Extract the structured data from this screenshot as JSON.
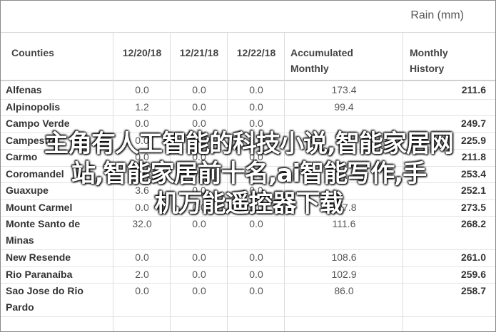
{
  "unit_label": "Rain (mm)",
  "headers": {
    "counties": "Counties",
    "d1": "12/20/18",
    "d2": "12/21/18",
    "d3": "12/22/18",
    "acc1": "Accumulated",
    "acc2": "Monthly",
    "hist1": "Monthly",
    "hist2": "History"
  },
  "rows": [
    {
      "name": [
        "Alfenas"
      ],
      "d1": "0.0",
      "d2": "0.0",
      "d3": "0.0",
      "acc": "173.4",
      "hist": "211.6"
    },
    {
      "name": [
        "Alpinopolis"
      ],
      "d1": "1.2",
      "d2": "0.0",
      "d3": "0.0",
      "acc": "99.4",
      "hist": ""
    },
    {
      "name": [
        "Campo Verde"
      ],
      "d1": "0.0",
      "d2": "0.0",
      "d3": "0.0",
      "acc": "",
      "hist": "249.7"
    },
    {
      "name": [
        "Campestre"
      ],
      "d1": "0.0",
      "d2": "0.0",
      "d3": "0.0",
      "acc": "",
      "hist": "225.9"
    },
    {
      "name": [
        "Carmo"
      ],
      "d1": "0.0",
      "d2": "0.0",
      "d3": "0.0",
      "acc": "",
      "hist": "211.8"
    },
    {
      "name": [
        "Coromandel"
      ],
      "d1": "0.0",
      "d2": "0.0",
      "d3": "0.0",
      "acc": "",
      "hist": "253.4"
    },
    {
      "name": [
        "Guaxupe"
      ],
      "d1": "3.6",
      "d2": "0.0",
      "d3": "0.0",
      "acc": "",
      "hist": "252.1"
    },
    {
      "name": [
        "Mount Carmel"
      ],
      "d1": "0.0",
      "d2": "0.0",
      "d3": "0.0",
      "acc": "187.8",
      "hist": "273.5"
    },
    {
      "name": [
        "Monte Santo de",
        "Minas"
      ],
      "d1": "32.0",
      "d2": "0.0",
      "d3": "0.0",
      "acc": "111.6",
      "hist": "268.2"
    },
    {
      "name": [
        "New Resende"
      ],
      "d1": "0.0",
      "d2": "0.0",
      "d3": "0.0",
      "acc": "108.6",
      "hist": "261.0"
    },
    {
      "name": [
        "Rio Paranaíba"
      ],
      "d1": "2.0",
      "d2": "0.0",
      "d3": "0.0",
      "acc": "102.9",
      "hist": "259.6"
    },
    {
      "name": [
        "Sao Jose do Rio",
        "Pardo"
      ],
      "d1": "0.0",
      "d2": "0.0",
      "d3": "0.0",
      "acc": "86.0",
      "hist": "258.7"
    }
  ],
  "overlay_lines": [
    "主角有人工智能的科技小说,智能家居网",
    "站,智能家居前十名,ai智能写作,手",
    "机万能遥控器下载"
  ]
}
